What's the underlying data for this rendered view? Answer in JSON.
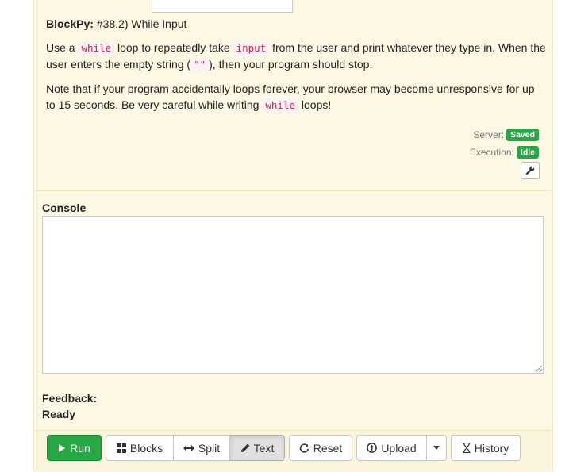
{
  "problem": {
    "label": "BlockPy:",
    "title": "#38.2) While Input",
    "line1_a": "Use a",
    "code_while": "while",
    "line1_b": "loop to repeatedly take",
    "code_input": "input",
    "line1_c": "from the user and print whatever they type in. When",
    "line2_a": "the user enters the empty string (",
    "code_empty": "\"\"",
    "line2_b": "), then your program should stop.",
    "para2_a": "Note that if your program accidentally loops forever, your browser may become unresponsive for up to 15 seconds. Be very careful while writing",
    "para2_code": "while",
    "para2_b": "loops!"
  },
  "status": {
    "server_label": "Server:",
    "server_value": "Saved",
    "execution_label": "Execution:",
    "execution_value": "Idle",
    "badge_color": "#27a745"
  },
  "console": {
    "label": "Console"
  },
  "feedback": {
    "label": "Feedback:",
    "status": "Ready"
  },
  "toolbar": {
    "run": "Run",
    "blocks": "Blocks",
    "split": "Split",
    "text": "Text",
    "reset": "Reset",
    "upload": "Upload",
    "history": "History"
  },
  "icons": {
    "run": "play-icon",
    "blocks": "grid-icon",
    "split": "arrows-horizontal-icon",
    "text": "pencil-icon",
    "reset": "refresh-icon",
    "upload": "upload-icon",
    "upload_menu": "caret-down-icon",
    "history": "hourglass-icon",
    "settings": "wrench-icon"
  },
  "colors": {
    "panel_bg": "#fcf8e3",
    "run_green": "#28a745",
    "code_pink": "#c7254e"
  }
}
